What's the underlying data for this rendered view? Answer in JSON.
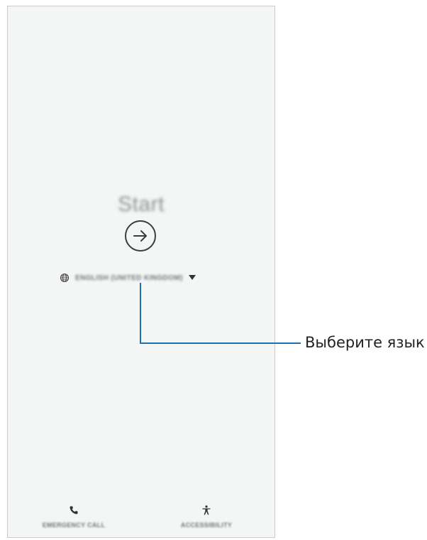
{
  "screen": {
    "title": "Start",
    "language": {
      "label": "ENGLISH (UNITED KINGDOM)"
    },
    "bottom_bar": {
      "emergency_call": "EMERGENCY CALL",
      "accessibility": "ACCESSIBILITY"
    }
  },
  "annotation": {
    "label": "Выберите язык"
  },
  "icons": [
    "arrow-right-icon",
    "globe-icon",
    "chevron-down-icon",
    "phone-icon",
    "accessibility-icon"
  ],
  "colors": {
    "callout_line": "#1f6fb4",
    "screen_background": "#f4f6f6"
  }
}
